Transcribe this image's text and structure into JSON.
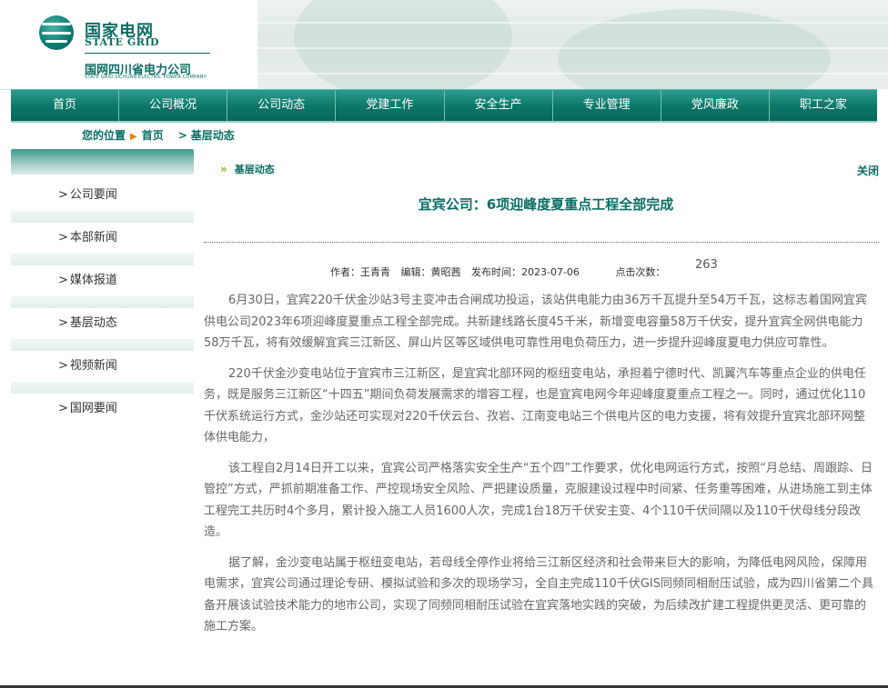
{
  "brand": {
    "cn": "国家电网",
    "en": "STATE GRID",
    "sub_cn": "国网四川省电力公司",
    "sub_en": "STATE GRID SICHUAN ELECTRIC POWER COMPANY"
  },
  "nav": {
    "items": [
      "首页",
      "公司概况",
      "公司动态",
      "党建工作",
      "安全生产",
      "专业管理",
      "党风廉政",
      "职工之家"
    ]
  },
  "breadcrumb": {
    "label": "您的位置",
    "home": "首页",
    "current": "基层动态"
  },
  "sidebar": {
    "items": [
      "公司要闻",
      "本部新闻",
      "媒体报道",
      "基层动态",
      "视频新闻",
      "国网要闻"
    ]
  },
  "section": {
    "title": "基层动态",
    "close": "关闭"
  },
  "article": {
    "title": "宜宾公司：6项迎峰度夏重点工程全部完成",
    "author": "作者：王青青",
    "editor": "编辑：黄昭茜",
    "date": "发布时间：2023-07-06",
    "clicks_label": "点击次数：",
    "clicks": "263",
    "paragraphs": [
      "6月30日，宜宾220千伏金沙站3号主变冲击合闸成功投运，该站供电能力由36万千瓦提升至54万千瓦，这标志着国网宜宾供电公司2023年6项迎峰度夏重点工程全部完成。共新建线路长度45千米，新增变电容量58万千伏安，提升宜宾全网供电能力58万千瓦，将有效缓解宜宾三江新区、屏山片区等区域供电可靠性用电负荷压力，进一步提升迎峰度夏电力供应可靠性。",
      "220千伏金沙变电站位于宜宾市三江新区，是宜宾北部环网的枢纽变电站，承担着宁德时代、凯翼汽车等重点企业的供电任务，既是服务三江新区“十四五”期间负荷发展需求的增容工程，也是宜宾电网今年迎峰度夏重点工程之一。同时，通过优化110千伏系统运行方式，金沙站还可实现对220千伏云台、孜岩、江南变电站三个供电片区的电力支援，将有效提升宜宾北部环网整体供电能力，",
      "该工程自2月14日开工以来，宜宾公司严格落实安全生产“五个四”工作要求，优化电网运行方式，按照“月总结、周跟踪、日管控”方式，严抓前期准备工作、严控现场安全风险、严把建设质量，克服建设过程中时间紧、任务重等困难，从进场施工到主体工程完工共历时4个多月，累计投入施工人员1600人次，完成1台18万千伏安主变、4个110千伏间隔以及110千伏母线分段改造。",
      "据了解，金沙变电站属于枢纽变电站，若母线全停作业将给三江新区经济和社会带来巨大的影响，为降低电网风险，保障用电需求，宜宾公司通过理论专研、模拟试验和多次的现场学习，全自主完成110千伏GIS同频同相耐压试验，成为四川省第二个具备开展该试验技术能力的地市公司，实现了同频同相耐压试验在宜宾落地实践的突破，为后续改扩建工程提供更灵活、更可靠的施工方案。"
    ]
  }
}
